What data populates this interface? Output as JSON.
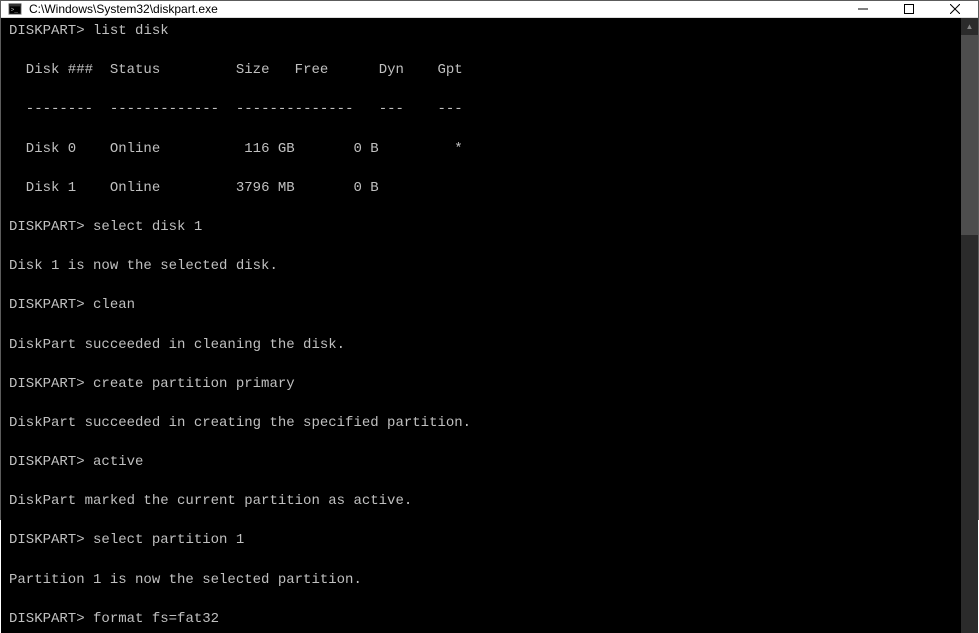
{
  "window": {
    "title": "C:\\Windows\\System32\\diskpart.exe"
  },
  "console": {
    "prompt": "DISKPART>",
    "cmd_list_disk": "list disk",
    "tbl_header_disk": "  Disk ###",
    "tbl_header_status": "Status",
    "tbl_header_size": "Size",
    "tbl_header_free": "Free",
    "tbl_header_dyn": "Dyn",
    "tbl_header_gpt": "Gpt",
    "tbl_sep_disk": "  --------",
    "tbl_sep_status": "-------------",
    "tbl_sep_size": "-------",
    "tbl_sep_free": "-------",
    "tbl_sep_dyn": "---",
    "tbl_sep_gpt": "---",
    "row0_disk": "  Disk 0",
    "row0_status": "Online",
    "row0_size": "116 GB",
    "row0_free": "0 B",
    "row0_dyn": "",
    "row0_gpt": "*",
    "row1_disk": "  Disk 1",
    "row1_status": "Online",
    "row1_size": "3796 MB",
    "row1_free": "0 B",
    "row1_dyn": "",
    "row1_gpt": "",
    "cmd_select_disk": "select disk 1",
    "msg_selected_disk": "Disk 1 is now the selected disk.",
    "cmd_clean": "clean",
    "msg_clean": "DiskPart succeeded in cleaning the disk.",
    "cmd_create_part": "create partition primary",
    "msg_create_part": "DiskPart succeeded in creating the specified partition.",
    "cmd_active": "active",
    "msg_active": "DiskPart marked the current partition as active.",
    "cmd_select_part": "select partition 1",
    "msg_select_part": "Partition 1 is now the selected partition.",
    "cmd_format": "format fs=fat32"
  }
}
